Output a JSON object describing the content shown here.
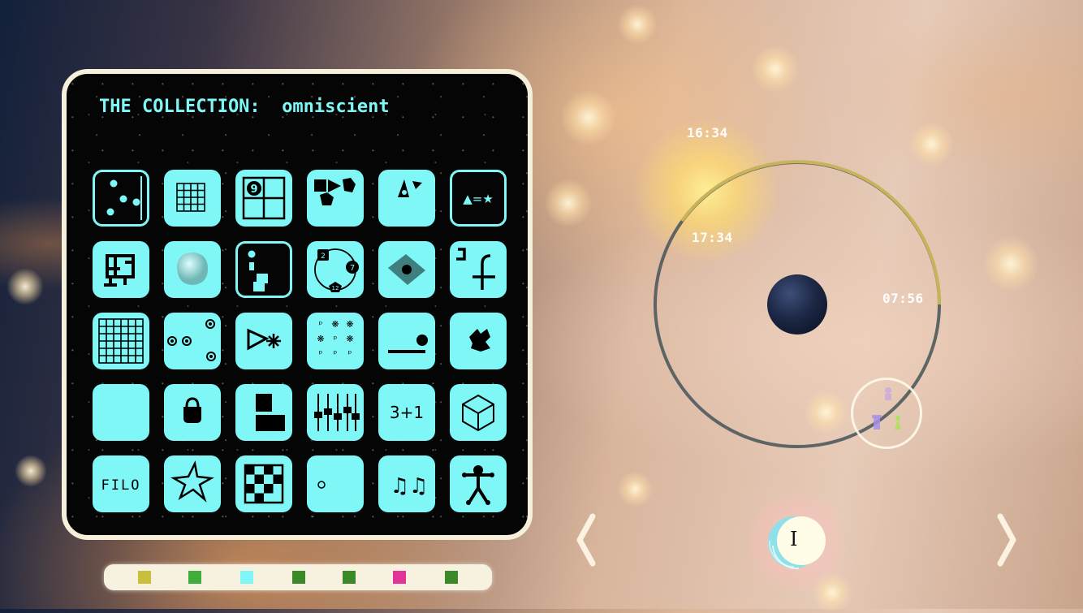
{
  "collection": {
    "title": "THE COLLECTION:",
    "name": "omniscient",
    "grid": [
      [
        {
          "id": "dots-die",
          "style": "dark"
        },
        {
          "id": "grid-small",
          "style": "fill"
        },
        {
          "id": "quad-nine",
          "style": "fill",
          "text": "9"
        },
        {
          "id": "shapes-pentagon",
          "style": "fill"
        },
        {
          "id": "cone-shape",
          "style": "fill"
        },
        {
          "id": "shape-equation",
          "style": "dark",
          "text": "▲=★"
        }
      ],
      [
        {
          "id": "rune-puzzle",
          "style": "fill"
        },
        {
          "id": "blob",
          "style": "fill"
        },
        {
          "id": "dot-blocks",
          "style": "dark"
        },
        {
          "id": "circle-numbers",
          "style": "fill",
          "labels": [
            "2",
            "7",
            "12"
          ]
        },
        {
          "id": "diamond-dot",
          "style": "fill"
        },
        {
          "id": "hooks",
          "style": "fill"
        }
      ],
      [
        {
          "id": "big-grid",
          "style": "fill"
        },
        {
          "id": "balls",
          "style": "fill"
        },
        {
          "id": "wedge-star",
          "style": "fill"
        },
        {
          "id": "flower-grid",
          "style": "fill"
        },
        {
          "id": "ball-ledge",
          "style": "fill"
        },
        {
          "id": "crumpled",
          "style": "fill"
        }
      ],
      [
        {
          "id": "blank",
          "style": "fill"
        },
        {
          "id": "lock",
          "style": "fill"
        },
        {
          "id": "blocks",
          "style": "fill"
        },
        {
          "id": "sliders",
          "style": "fill"
        },
        {
          "id": "sum",
          "style": "fill",
          "text": "3+1"
        },
        {
          "id": "cube",
          "style": "fill"
        }
      ],
      [
        {
          "id": "filo",
          "style": "fill",
          "text": "FILO"
        },
        {
          "id": "star",
          "style": "fill"
        },
        {
          "id": "checker",
          "style": "fill"
        },
        {
          "id": "small-circle",
          "style": "fill"
        },
        {
          "id": "music-notes",
          "style": "fill",
          "text": "♫♫"
        },
        {
          "id": "stick-figure",
          "style": "fill"
        }
      ]
    ]
  },
  "progress_swatches": [
    "#c8c03a",
    "#3fae3a",
    "#7ff7f7",
    "#3a8a2a",
    "#3a8a2a",
    "#e0349a",
    "#3a8a2a"
  ],
  "orbit": {
    "times": [
      "16:34",
      "17:34",
      "07:56"
    ],
    "arc_color": "#c8b25a",
    "ring_color": "#4f5a5c"
  },
  "moons": [
    "purple-figure-icon",
    "purple-tower-icon",
    "green-figure-icon"
  ],
  "player": {
    "cursor": "I"
  },
  "nav": {
    "prev": "chevron-left-icon",
    "next": "chevron-right-icon"
  },
  "colors": {
    "accent": "#7ff7f7",
    "panel_border": "#f6efd9"
  }
}
